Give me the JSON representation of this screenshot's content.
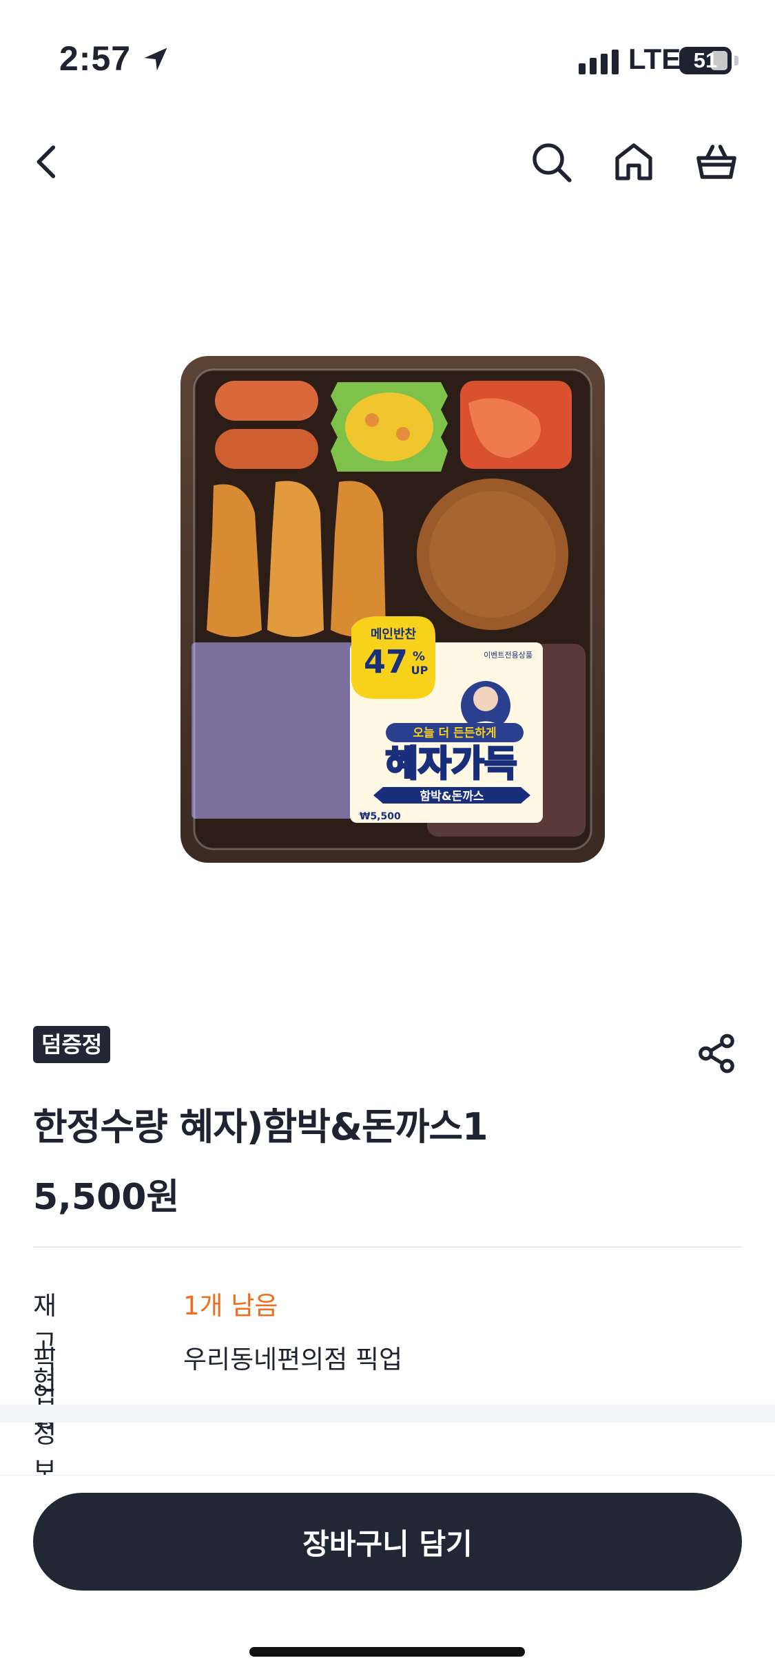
{
  "status_bar": {
    "time": "2:57",
    "network": "LTE",
    "battery": "51"
  },
  "nav": {
    "back_icon": "chevron-left-icon",
    "search_icon": "search-icon",
    "home_icon": "home-icon",
    "cart_icon": "shopping-basket-icon"
  },
  "product": {
    "badge": "덤증정",
    "name": "한정수량 혜자)함박&돈까스1",
    "price": "5,500원",
    "image_label": {
      "promo_top": "메인반찬",
      "promo_percent": "47",
      "promo_unit": "%",
      "promo_up": "UP",
      "event_tag": "이벤트전용상품",
      "slogan": "오늘 더 든든하게",
      "brand": "혜자가득",
      "menu": "함박&돈까스",
      "footer": "₩5,500"
    }
  },
  "info": {
    "stock_label": "재고 현황",
    "stock_value": "1개 남음",
    "pickup_label": "픽업 정보",
    "pickup_value": "우리동네편의점 픽업"
  },
  "actions": {
    "add_to_cart": "장바구니 담기",
    "share_icon": "share-icon"
  },
  "colors": {
    "accent": "#f26c1b",
    "dark": "#222735",
    "placeholder": "#7b6f9e"
  }
}
